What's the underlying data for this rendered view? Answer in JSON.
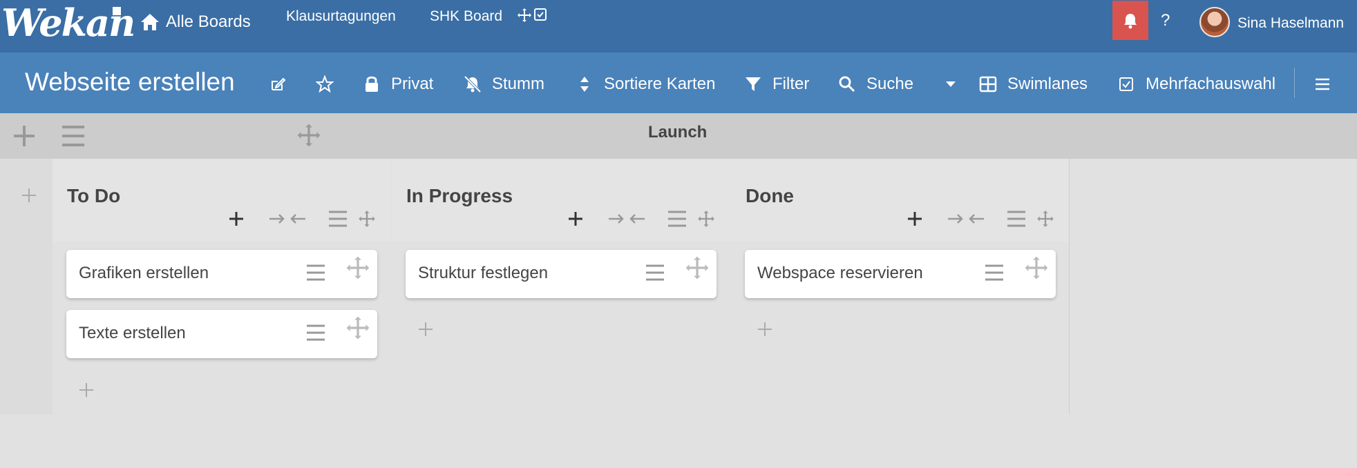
{
  "header": {
    "logo": "Wekan",
    "home_label": "Alle Boards",
    "links": [
      "Klausurtagungen",
      "SHK Board"
    ],
    "help": "?",
    "username": "Sina Haselmann",
    "bell_color": "#d9534f"
  },
  "board": {
    "title": "Webseite erstellen",
    "privacy": "Privat",
    "mute": "Stumm",
    "sort": "Sortiere Karten",
    "filter": "Filter",
    "search": "Suche",
    "view": "Swimlanes",
    "multiselect": "Mehrfachauswahl"
  },
  "swimlane": {
    "title": "Launch"
  },
  "lists": [
    {
      "title": "To Do",
      "cards": [
        "Grafiken erstellen",
        "Texte erstellen"
      ]
    },
    {
      "title": "In Progress",
      "cards": [
        "Struktur festlegen"
      ]
    },
    {
      "title": "Done",
      "cards": [
        "Webspace reservieren"
      ]
    }
  ],
  "colors": {
    "header": "#3a6ea5",
    "board_header": "#4a82ba",
    "swimlane": "#cccccc"
  }
}
